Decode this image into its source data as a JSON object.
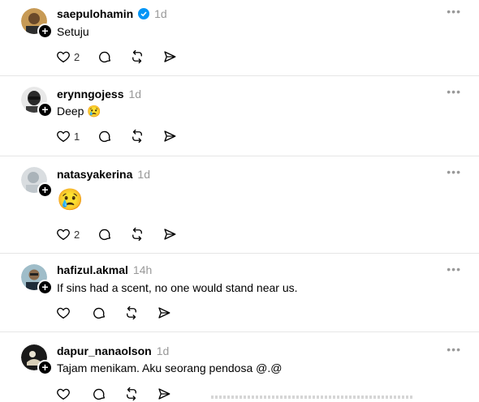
{
  "posts": [
    {
      "username": "saepulohamin",
      "verified": true,
      "time": "1d",
      "text": "Setuju",
      "likes": "2"
    },
    {
      "username": "erynngojess",
      "verified": false,
      "time": "1d",
      "text": "Deep 😢",
      "likes": "1"
    },
    {
      "username": "natasyakerina",
      "verified": false,
      "time": "1d",
      "text": "😢",
      "likes": "2"
    },
    {
      "username": "hafizul.akmal",
      "verified": false,
      "time": "14h",
      "text": "If sins had a scent, no one would stand near us.",
      "likes": ""
    },
    {
      "username": "dapur_nanaolson",
      "verified": false,
      "time": "1d",
      "text": "Tajam menikam. Aku seorang pendosa @.@",
      "likes": ""
    }
  ],
  "ui": {
    "more_label": "•••",
    "follow_glyph": "+"
  },
  "colors": {
    "verified": "#0095f6",
    "muted": "#999999",
    "divider": "#e6e6e6"
  },
  "icons": [
    "heart-icon",
    "comment-icon",
    "repost-icon",
    "share-icon",
    "verified-badge-icon",
    "more-options-icon",
    "follow-plus-icon"
  ]
}
